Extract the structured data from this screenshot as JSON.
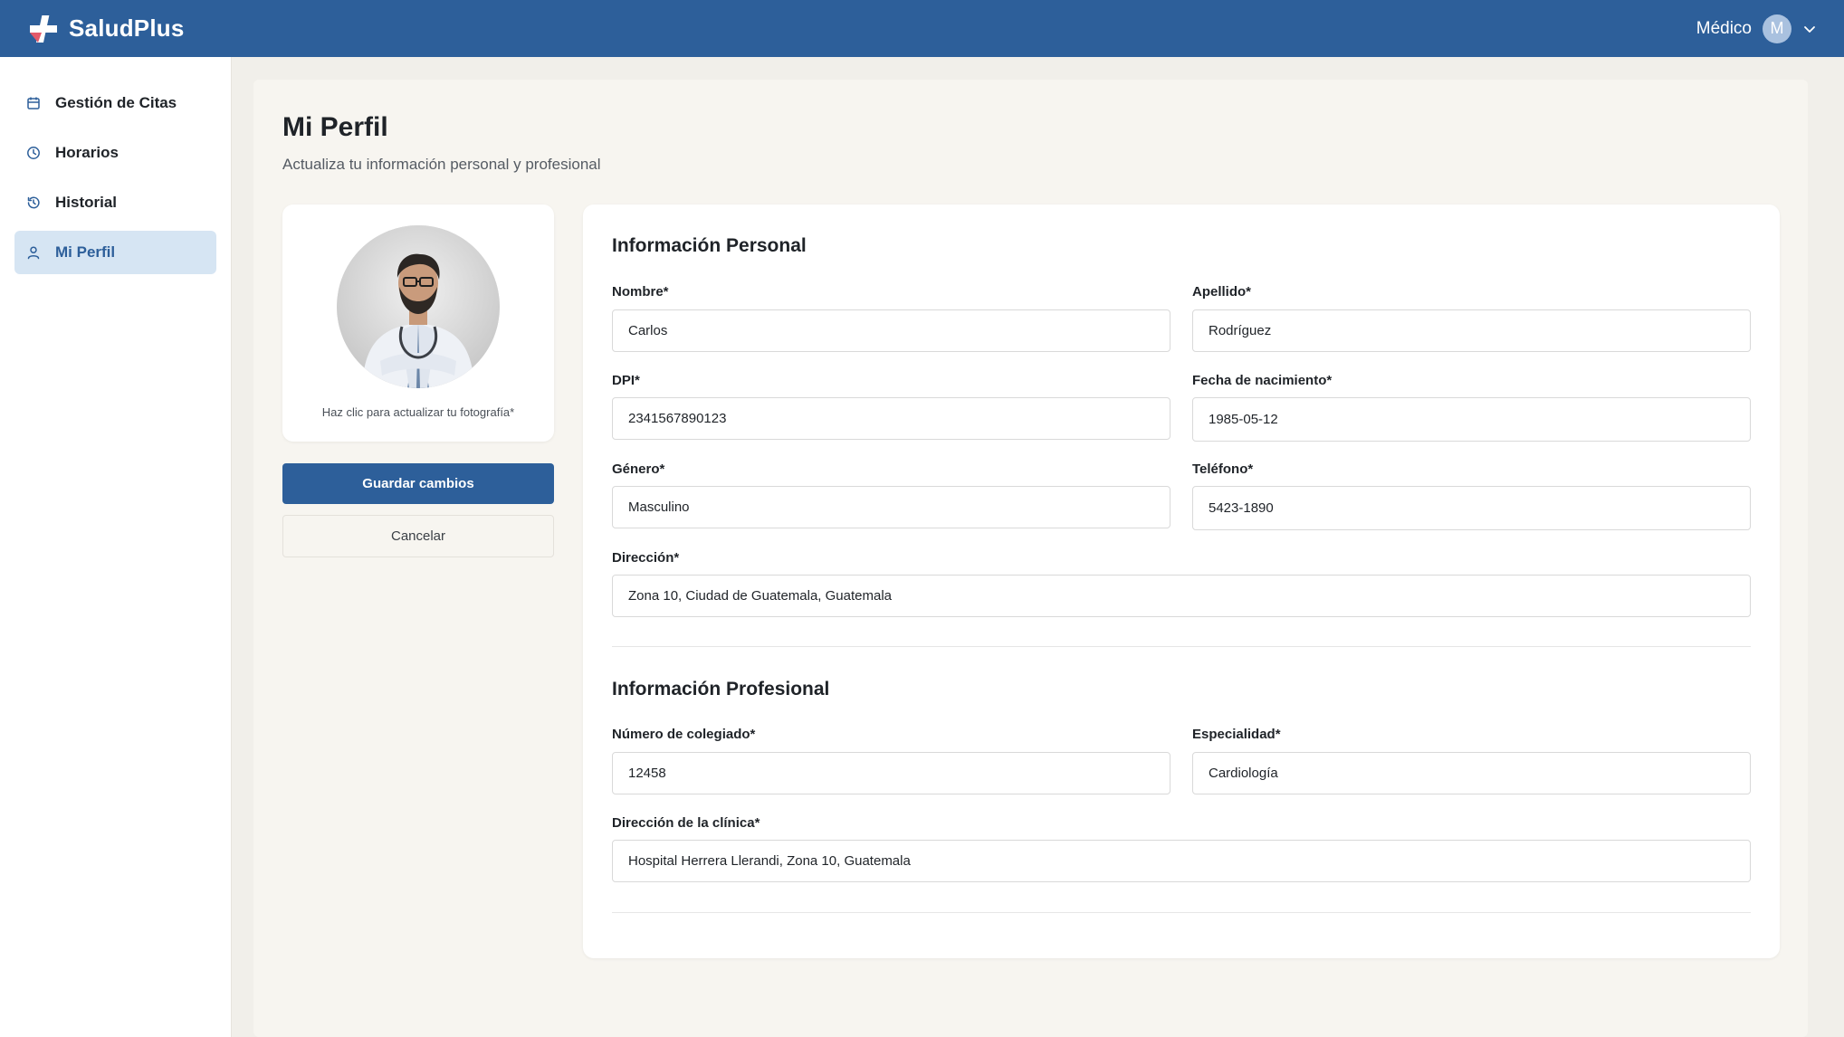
{
  "header": {
    "brand": "SaludPlus",
    "role": "Médico",
    "avatar_initial": "M"
  },
  "sidebar": {
    "items": [
      {
        "label": "Gestión de Citas",
        "icon": "calendar-icon",
        "active": false
      },
      {
        "label": "Horarios",
        "icon": "clock-icon",
        "active": false
      },
      {
        "label": "Historial",
        "icon": "history-icon",
        "active": false
      },
      {
        "label": "Mi Perfil",
        "icon": "user-icon",
        "active": true
      }
    ]
  },
  "page": {
    "title": "Mi Perfil",
    "subtitle": "Actualiza tu información personal y profesional"
  },
  "photo_card": {
    "hint": "Haz clic para actualizar tu fotografía*"
  },
  "actions": {
    "save": "Guardar cambios",
    "cancel": "Cancelar"
  },
  "personal": {
    "title": "Información Personal",
    "nombre": {
      "label": "Nombre*",
      "value": "Carlos"
    },
    "apellido": {
      "label": "Apellido*",
      "value": "Rodríguez"
    },
    "dpi": {
      "label": "DPI*",
      "value": "2341567890123"
    },
    "fecha": {
      "label": "Fecha de nacimiento*",
      "value": "1985-05-12"
    },
    "genero": {
      "label": "Género*",
      "value": "Masculino"
    },
    "telefono": {
      "label": "Teléfono*",
      "value": "5423-1890"
    },
    "direccion": {
      "label": "Dirección*",
      "value": "Zona 10, Ciudad de Guatemala, Guatemala"
    }
  },
  "professional": {
    "title": "Información Profesional",
    "colegiado": {
      "label": "Número de colegiado*",
      "value": "12458"
    },
    "especialidad": {
      "label": "Especialidad*",
      "value": "Cardiología"
    },
    "clinica": {
      "label": "Dirección de la clínica*",
      "value": "Hospital Herrera Llerandi, Zona 10, Guatemala"
    }
  },
  "colors": {
    "primary": "#2d5f9a",
    "active_nav_bg": "#d6e5f3",
    "page_bg": "#f1efea"
  }
}
